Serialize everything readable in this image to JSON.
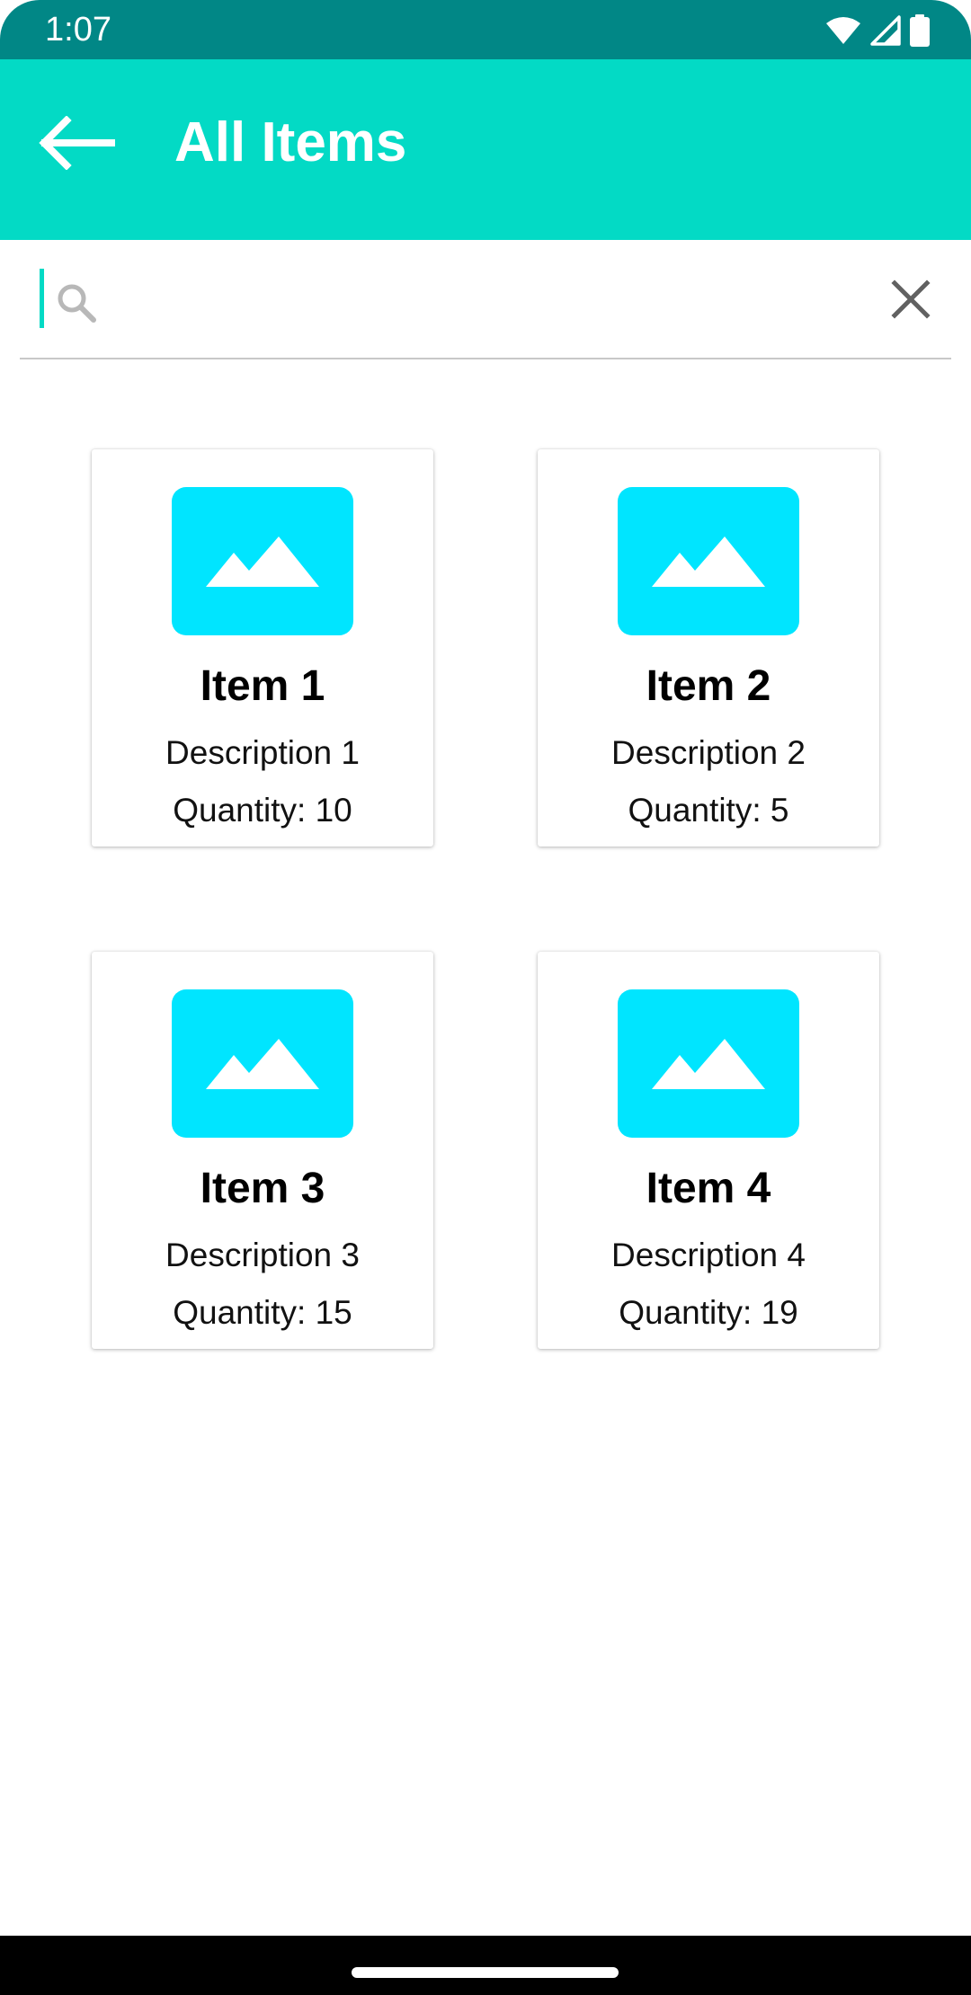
{
  "status_bar": {
    "time": "1:07",
    "icons": [
      "wifi-icon",
      "cell-signal-icon",
      "battery-icon"
    ]
  },
  "app_bar": {
    "title": "All Items",
    "back_icon": "arrow-left-icon",
    "color": "#03dac5"
  },
  "search": {
    "value": "",
    "placeholder": "",
    "search_icon": "search-icon",
    "clear_icon": "close-icon"
  },
  "items": [
    {
      "title": "Item 1",
      "description": "Description 1",
      "quantity": "Quantity: 10",
      "image_icon": "image-placeholder-icon"
    },
    {
      "title": "Item 2",
      "description": "Description 2",
      "quantity": "Quantity: 5",
      "image_icon": "image-placeholder-icon"
    },
    {
      "title": "Item 3",
      "description": "Description 3",
      "quantity": "Quantity: 15",
      "image_icon": "image-placeholder-icon"
    },
    {
      "title": "Item 4",
      "description": "Description 4",
      "quantity": "Quantity: 19",
      "image_icon": "image-placeholder-icon"
    }
  ],
  "colors": {
    "status_bar": "#018786",
    "accent": "#03dac5",
    "image_placeholder": "#00e5ff"
  }
}
